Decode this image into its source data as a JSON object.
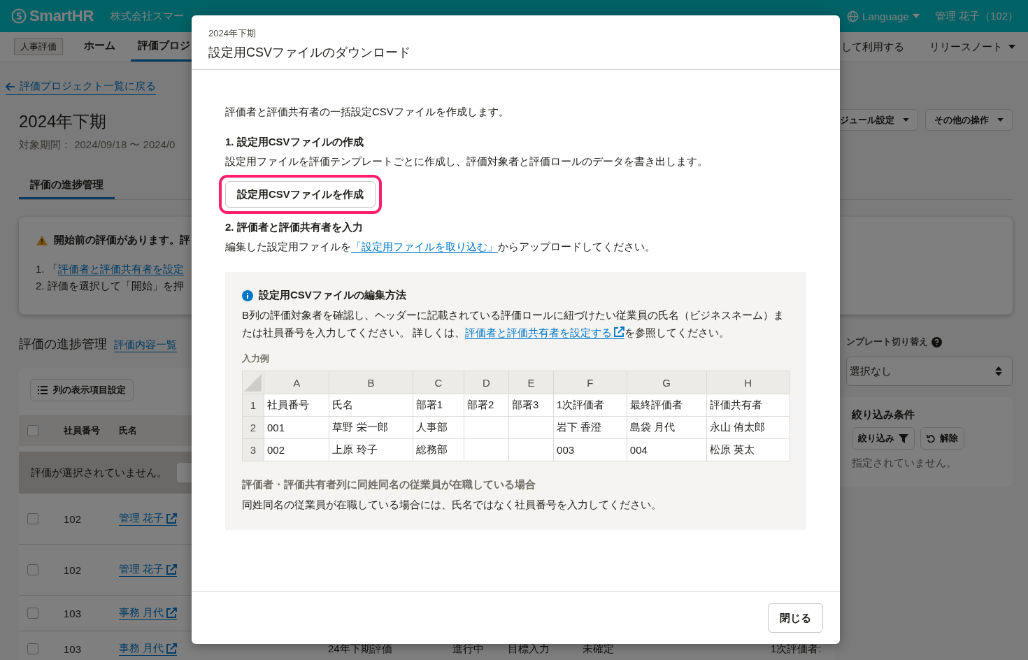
{
  "header": {
    "logo": "SmartHR",
    "company": "株式会社スマー",
    "language": "Language",
    "user": "管理 花子（102）"
  },
  "nav": {
    "app_tag": "人事評価",
    "items": [
      {
        "label": "ホーム",
        "selected": false
      },
      {
        "label": "評価プロジ",
        "selected": true
      }
    ],
    "right": [
      {
        "label": "して利用する",
        "kind": "link"
      },
      {
        "label": "リリースノート",
        "kind": "menu"
      }
    ]
  },
  "page": {
    "back_link": "評価プロジェクト一覧に戻る",
    "title": "2024年下期",
    "period": "対象期間： 2024/09/18 〜 2024/0",
    "actions": [
      "ジュール設定",
      "その他の操作"
    ],
    "tabs": [
      {
        "label": "評価の進捗管理",
        "selected": true
      }
    ],
    "alert": {
      "title": "開始前の評価があります。評",
      "steps": [
        {
          "text": "1. 「",
          "link": "評価者と評価共有者を設定"
        },
        {
          "text": "2. 評価を選択して「開始」を押"
        }
      ]
    }
  },
  "progress": {
    "heading": "評価の進捗管理",
    "link": "評価内容一覧",
    "column_settings": "列の表示項目設定",
    "header_checked": false,
    "columns": [
      "社員番号",
      "氏名"
    ],
    "empty_selection": "評価が選択されていません。",
    "rows": [
      {
        "id": "102",
        "name": "管理 花子",
        "checked": false
      },
      {
        "id": "102",
        "name": "管理 花子",
        "checked": false
      },
      {
        "id": "103",
        "name": "事務 月代",
        "checked": false
      },
      {
        "id": "103",
        "name": "事務 月代",
        "checked": false,
        "cells": [
          "24年下期評価",
          "進行中",
          "目標入力",
          "未確定",
          "1次評価者:"
        ]
      }
    ]
  },
  "sidebar": {
    "template_label": "ンプレート切り替え",
    "template_value": "選択なし",
    "filter": {
      "title": "絞り込み条件",
      "filter_button": "絞り込み",
      "clear_button": "解除",
      "status": "指定されていません。"
    }
  },
  "modal": {
    "subtitle": "2024年下期",
    "title": "設定用CSVファイルのダウンロード",
    "intro": "評価者と評価共有者の一括設定CSVファイルを作成します。",
    "step1": {
      "heading": "1. 設定用CSVファイルの作成",
      "text": "設定用ファイルを評価テンプレートごとに作成し、評価対象者と評価ロールのデータを書き出します。",
      "button": "設定用CSVファイルを作成",
      "highlighted": true
    },
    "step2": {
      "heading": "2. 評価者と評価共有者を入力",
      "text_before": "編集した設定用ファイルを",
      "link": "「設定用ファイルを取り込む」",
      "text_after": "からアップロードしてください。"
    },
    "info": {
      "title": "設定用CSVファイルの編集方法",
      "text_before": "B列の評価対象者を確認し、ヘッダーに記載されている評価ロールに紐づけたい従業員の氏名（ビジネスネーム）または社員番号を入力してください。 詳しくは、",
      "link": "評価者と評価共有者を設定する",
      "text_after": "を参照してください。",
      "example_label": "入力例",
      "columns": [
        "A",
        "B",
        "C",
        "D",
        "E",
        "F",
        "G",
        "H"
      ],
      "rows": [
        {
          "number": "1",
          "cells": [
            "社員番号",
            "氏名",
            "部署1",
            "部署2",
            "部署3",
            "1次評価者",
            "最終評価者",
            "評価共有者"
          ]
        },
        {
          "number": "2",
          "cells": [
            "001",
            "草野 栄一郎",
            "人事部",
            null,
            null,
            "岩下 香澄",
            "島袋 月代",
            "永山 侑太郎"
          ]
        },
        {
          "number": "3",
          "cells": [
            "002",
            "上原 玲子",
            "総務部",
            null,
            null,
            "003",
            "004",
            "松原 英太"
          ]
        }
      ],
      "note_title": "評価者・評価共有者列に同姓同名の従業員が在職している場合",
      "note_text": "同姓同名の従業員が在職している場合には、氏名ではなく社員番号を入力してください。"
    },
    "close_button": "閉じる"
  }
}
